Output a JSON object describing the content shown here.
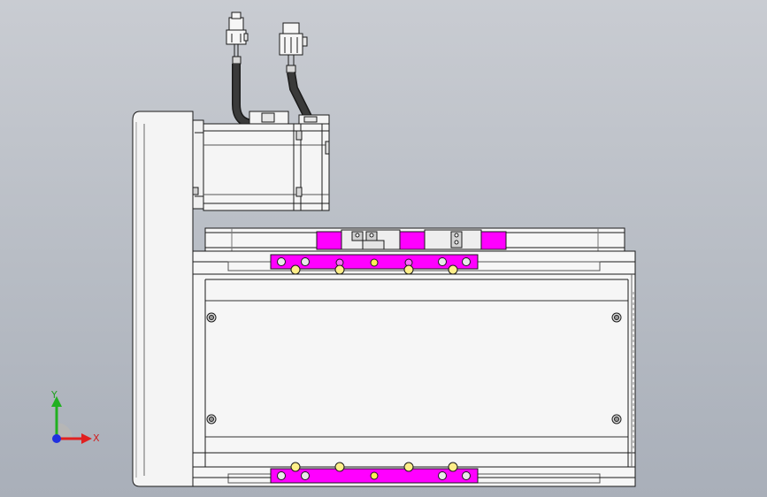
{
  "viewport": {
    "background_top": "#c9ccd2",
    "background_bottom": "#a9afb9"
  },
  "model": {
    "line_color": "#1a1a1a",
    "face_color": "#f2f2f2",
    "slider_color": "#ff00ff",
    "cable_color": "#2a2a2a"
  },
  "triad": {
    "x_label": "X",
    "y_label": "Y",
    "x_color": "#e02020",
    "y_color": "#20b020",
    "z_color": "#2030e0"
  }
}
